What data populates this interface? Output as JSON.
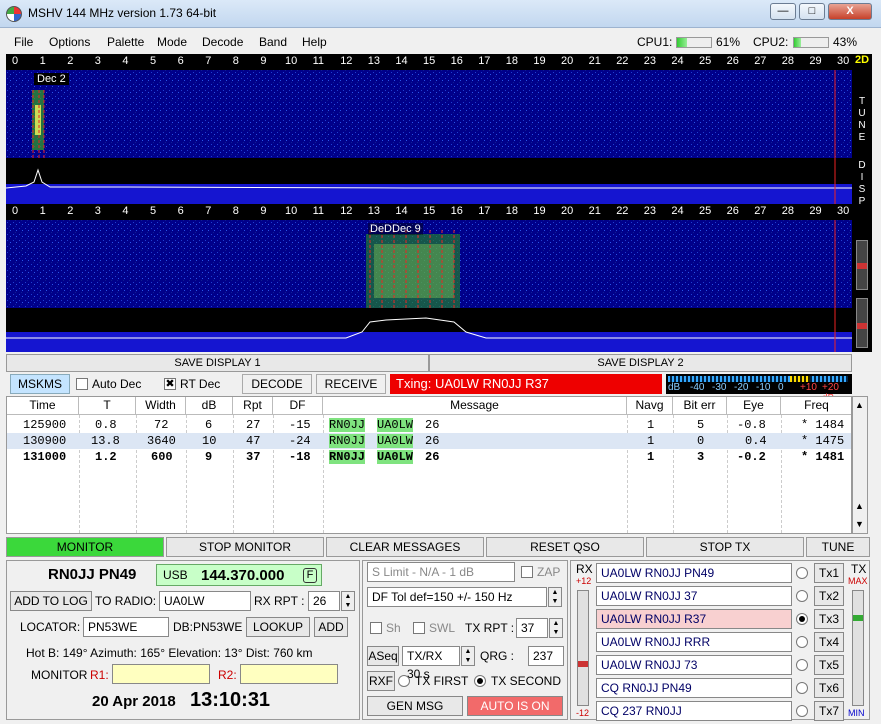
{
  "window": {
    "title": "MSHV 144 MHz version 1.73 64-bit",
    "minimize": "—",
    "maximize": "□",
    "close": "X"
  },
  "menu": [
    "File",
    "Options",
    "Palette",
    "Mode",
    "Decode",
    "Band",
    "Help"
  ],
  "cpu": {
    "cpu1_label": "CPU1:",
    "cpu1_value": "61%",
    "cpu2_label": "CPU2:",
    "cpu2_value": "43%"
  },
  "ruler_ticks": [
    "0",
    "1",
    "2",
    "3",
    "4",
    "5",
    "6",
    "7",
    "8",
    "9",
    "10",
    "11",
    "12",
    "13",
    "14",
    "15",
    "16",
    "17",
    "18",
    "19",
    "20",
    "21",
    "22",
    "23",
    "24",
    "25",
    "26",
    "27",
    "28",
    "29",
    "30"
  ],
  "wf1": {
    "label": "Dec 2"
  },
  "wf2": {
    "label": "DeDDec 9"
  },
  "side": {
    "btn_2d": "2D",
    "tune": "T U N E",
    "disp": "D I S P"
  },
  "save": {
    "one": "SAVE DISPLAY 1",
    "two": "SAVE DISPLAY 2"
  },
  "toolbar": {
    "mode": "MSKMS",
    "auto_dec": "Auto Dec",
    "rt_dec": "RT Dec",
    "rt_dec_check": "✖",
    "decode": "DECODE",
    "receive": "RECEIVE",
    "txing": "Txing: UA0LW RN0JJ R37"
  },
  "dbscale": [
    "dB",
    "-40",
    "-30",
    "-20",
    "-10",
    "0",
    "+10",
    "+20 dB"
  ],
  "table": {
    "headers": [
      "Time",
      "T",
      "Width",
      "dB",
      "Rpt",
      "DF",
      "Message",
      "Navg",
      "Bit err",
      "Eye",
      "Freq"
    ],
    "rows": [
      {
        "time": "125900",
        "t": "0.8",
        "width": "72",
        "db": "6",
        "rpt": "27",
        "df": "-15",
        "c1": "RN0JJ",
        "c2": "UA0LW",
        "rest": "26",
        "navg": "1",
        "biterr": "5",
        "eye": "-0.8",
        "freq": "* 1484"
      },
      {
        "time": "130900",
        "t": "13.8",
        "width": "3640",
        "db": "10",
        "rpt": "47",
        "df": "-24",
        "c1": "RN0JJ",
        "c2": "UA0LW",
        "rest": "26",
        "navg": "1",
        "biterr": "0",
        "eye": "0.4",
        "freq": "* 1475"
      },
      {
        "time": "131000",
        "t": "1.2",
        "width": "600",
        "db": "9",
        "rpt": "37",
        "df": "-18",
        "c1": "RN0JJ",
        "c2": "UA0LW",
        "rest": "26",
        "navg": "1",
        "biterr": "3",
        "eye": "-0.2",
        "freq": "* 1481"
      }
    ]
  },
  "controls": {
    "monitor": "MONITOR",
    "stop_monitor": "STOP MONITOR",
    "clear": "CLEAR MESSAGES",
    "reset": "RESET QSO",
    "stop_tx": "STOP TX",
    "tune": "TUNE"
  },
  "station": {
    "my_call": "RN0JJ PN49",
    "usb": "USB",
    "freq": "144.370.000",
    "f_btn": "F",
    "add_log": "ADD TO LOG",
    "to_radio_lbl": "TO RADIO:",
    "to_radio": "UA0LW",
    "rx_rpt_lbl": "RX RPT :",
    "rx_rpt": "26",
    "locator_lbl": "LOCATOR:",
    "locator": "PN53WE",
    "db_lbl": "DB:PN53WE",
    "lookup": "LOOKUP",
    "add": "ADD",
    "geo": "Hot B: 149°   Azimuth: 165°   Elevation: 13°   Dist: 760 km",
    "monitor_lbl": "MONITOR",
    "r1": "R1:",
    "r2": "R2:",
    "date": "20 Apr 2018",
    "time": "13:10:31"
  },
  "mid": {
    "slimit": "S Limit - N/A - 1  dB",
    "zap": "ZAP",
    "dftol": "DF Tol def=150 +/-  150  Hz",
    "sh": "Sh",
    "swl": "SWL",
    "tx_rpt_lbl": "TX RPT :",
    "tx_rpt": "37",
    "aseq": "ASeq",
    "txrx": "TX/RX 30  s",
    "qrg_lbl": "QRG :",
    "qrg": "237",
    "rxf": "RXF",
    "tx_first": "TX FIRST",
    "tx_second": "TX SECOND",
    "gen_msg": "GEN MSG",
    "auto_is_on": "AUTO IS ON"
  },
  "tx": {
    "rx_lbl": "RX",
    "plus12": "+12",
    "minus12": "-12",
    "tx_lbl": "TX",
    "max": "MAX",
    "min": "MIN",
    "msgs": [
      "UA0LW RN0JJ PN49",
      "UA0LW RN0JJ 37",
      "UA0LW RN0JJ R37",
      "UA0LW RN0JJ RRR",
      "UA0LW RN0JJ 73",
      "CQ RN0JJ PN49",
      "CQ 237 RN0JJ"
    ],
    "btns": [
      "Tx1",
      "Tx2",
      "Tx3",
      "Tx4",
      "Tx5",
      "Tx6",
      "Tx7"
    ]
  },
  "colors": {
    "monitor_on": "#3bd83b",
    "txing": "#e00000",
    "auto_on": "#f26a6a",
    "selected_tx": "#f8d0d0",
    "waterfall": "#00008a"
  }
}
